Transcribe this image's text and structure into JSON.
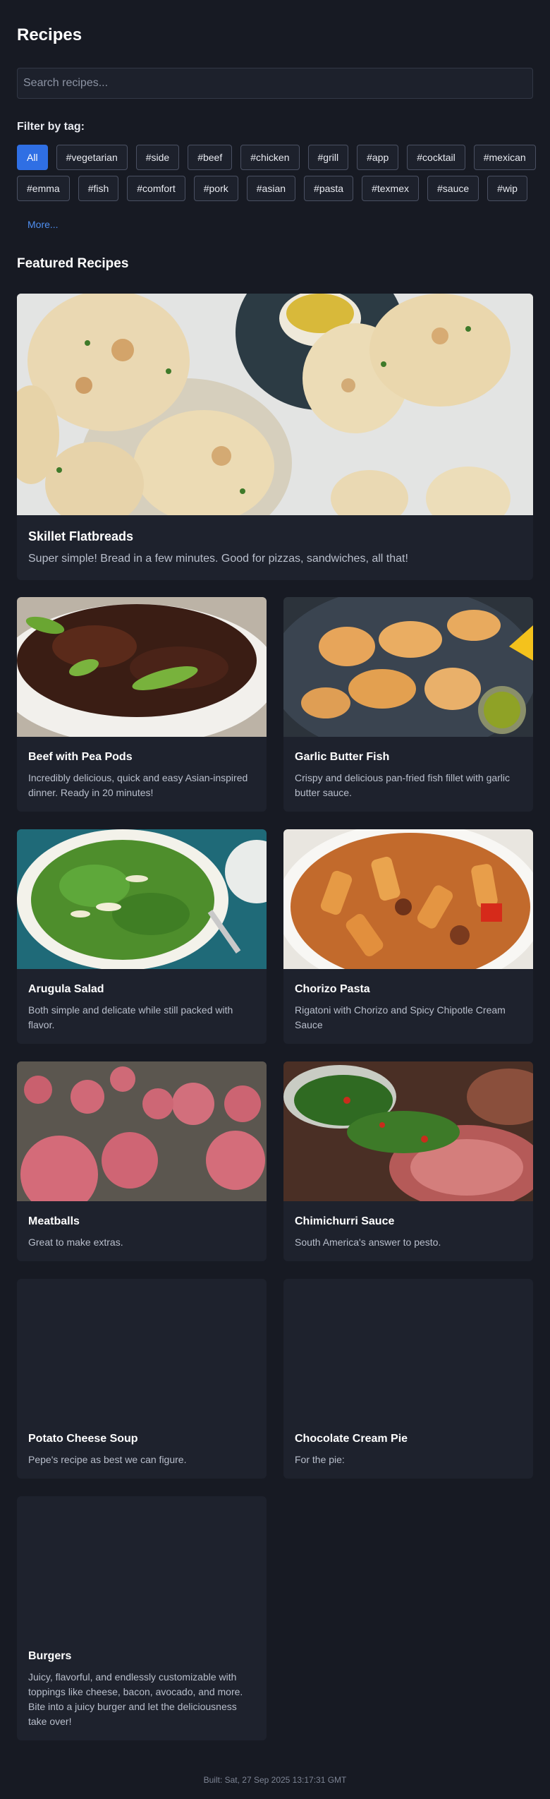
{
  "page": {
    "title": "Recipes"
  },
  "search": {
    "placeholder": "Search recipes..."
  },
  "filter": {
    "label": "Filter by tag:",
    "tags": [
      "All",
      "#vegetarian",
      "#side",
      "#beef",
      "#chicken",
      "#grill",
      "#app",
      "#cocktail",
      "#mexican",
      "#emma",
      "#fish",
      "#comfort",
      "#pork",
      "#asian",
      "#pasta",
      "#texmex",
      "#sauce",
      "#wip"
    ],
    "active_tag": "All",
    "more_label": "More..."
  },
  "featured": {
    "heading": "Featured Recipes",
    "title": "Skillet Flatbreads",
    "description": "Super simple! Bread in a few minutes. Good for pizzas, sandwiches, all that!"
  },
  "recipes": [
    {
      "title": "Beef with Pea Pods",
      "description": "Incredibly delicious, quick and easy Asian-inspired dinner. Ready in 20 minutes!"
    },
    {
      "title": "Garlic Butter Fish",
      "description": "Crispy and delicious pan-fried fish fillet with garlic butter sauce."
    },
    {
      "title": "Arugula Salad",
      "description": "Both simple and delicate while still packed with flavor."
    },
    {
      "title": "Chorizo Pasta",
      "description": "Rigatoni with Chorizo and Spicy Chipotle Cream Sauce"
    },
    {
      "title": "Meatballs",
      "description": "Great to make extras."
    },
    {
      "title": "Chimichurri Sauce",
      "description": "South America's answer to pesto."
    },
    {
      "title": "Potato Cheese Soup",
      "description": "Pepe's recipe as best we can figure."
    },
    {
      "title": "Chocolate Cream Pie",
      "description": "For the pie:"
    },
    {
      "title": "Burgers",
      "description": "Juicy, flavorful, and endlessly customizable with toppings like cheese, bacon, avocado, and more. Bite into a juicy burger and let the deliciousness take over!"
    }
  ],
  "footer": {
    "built": "Built: Sat, 27 Sep 2025 13:17:31 GMT"
  },
  "colors": {
    "background": "#171a23",
    "card": "#1e222d",
    "accent": "#2f6fe4",
    "link": "#4f8ff0"
  }
}
